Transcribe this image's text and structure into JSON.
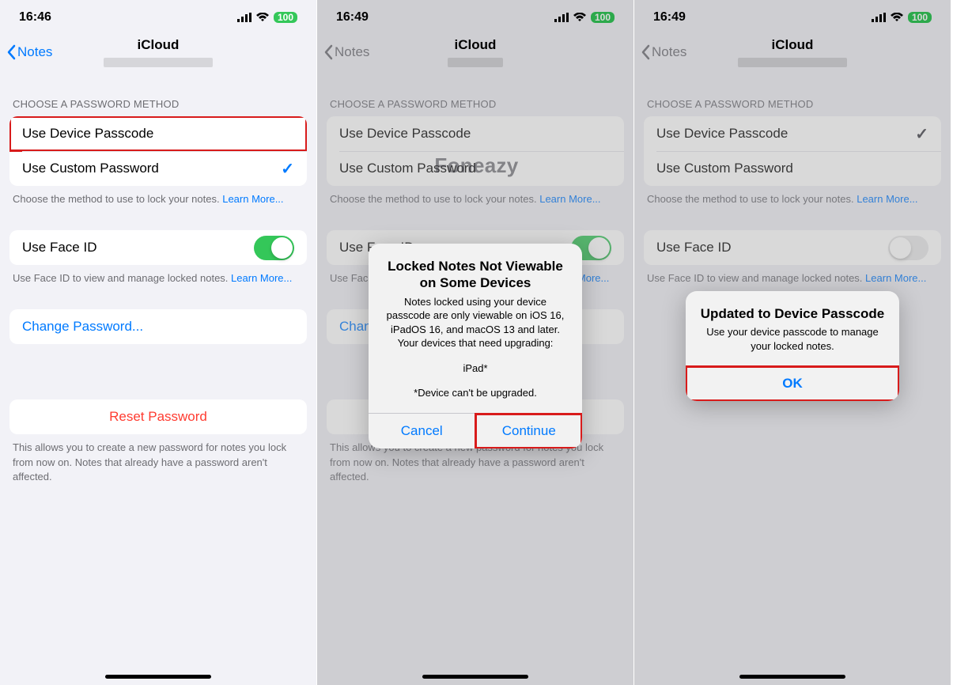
{
  "watermark": "Foneazy",
  "screen1": {
    "status": {
      "time": "16:46",
      "battery": "100"
    },
    "nav": {
      "back": "Notes",
      "title": "iCloud"
    },
    "section_header": "CHOOSE A PASSWORD METHOD",
    "method_device": "Use Device Passcode",
    "method_custom": "Use Custom Password",
    "method_caption": "Choose the method to use to lock your notes. ",
    "learn_more": "Learn More...",
    "faceid_label": "Use Face ID",
    "faceid_caption": "Use Face ID to view and manage locked notes. ",
    "change_pw": "Change Password...",
    "reset_pw": "Reset Password",
    "reset_caption": "This allows you to create a new password for notes you lock from now on. Notes that already have a password aren't affected."
  },
  "screen2": {
    "status": {
      "time": "16:49",
      "battery": "100"
    },
    "nav": {
      "back": "Notes",
      "title": "iCloud"
    },
    "alert": {
      "title": "Locked Notes Not Viewable on Some Devices",
      "message_l1": "Notes locked using your device passcode are only viewable on iOS 16, iPadOS 16, and macOS 13 and later. Your devices that need upgrading:",
      "device": "iPad*",
      "footnote": "*Device can't be upgraded.",
      "cancel": "Cancel",
      "continue": "Continue"
    }
  },
  "screen3": {
    "status": {
      "time": "16:49",
      "battery": "100"
    },
    "nav": {
      "back": "Notes",
      "title": "iCloud"
    },
    "alert": {
      "title": "Updated to Device Passcode",
      "message": "Use your device passcode to manage your locked notes.",
      "ok": "OK"
    }
  }
}
